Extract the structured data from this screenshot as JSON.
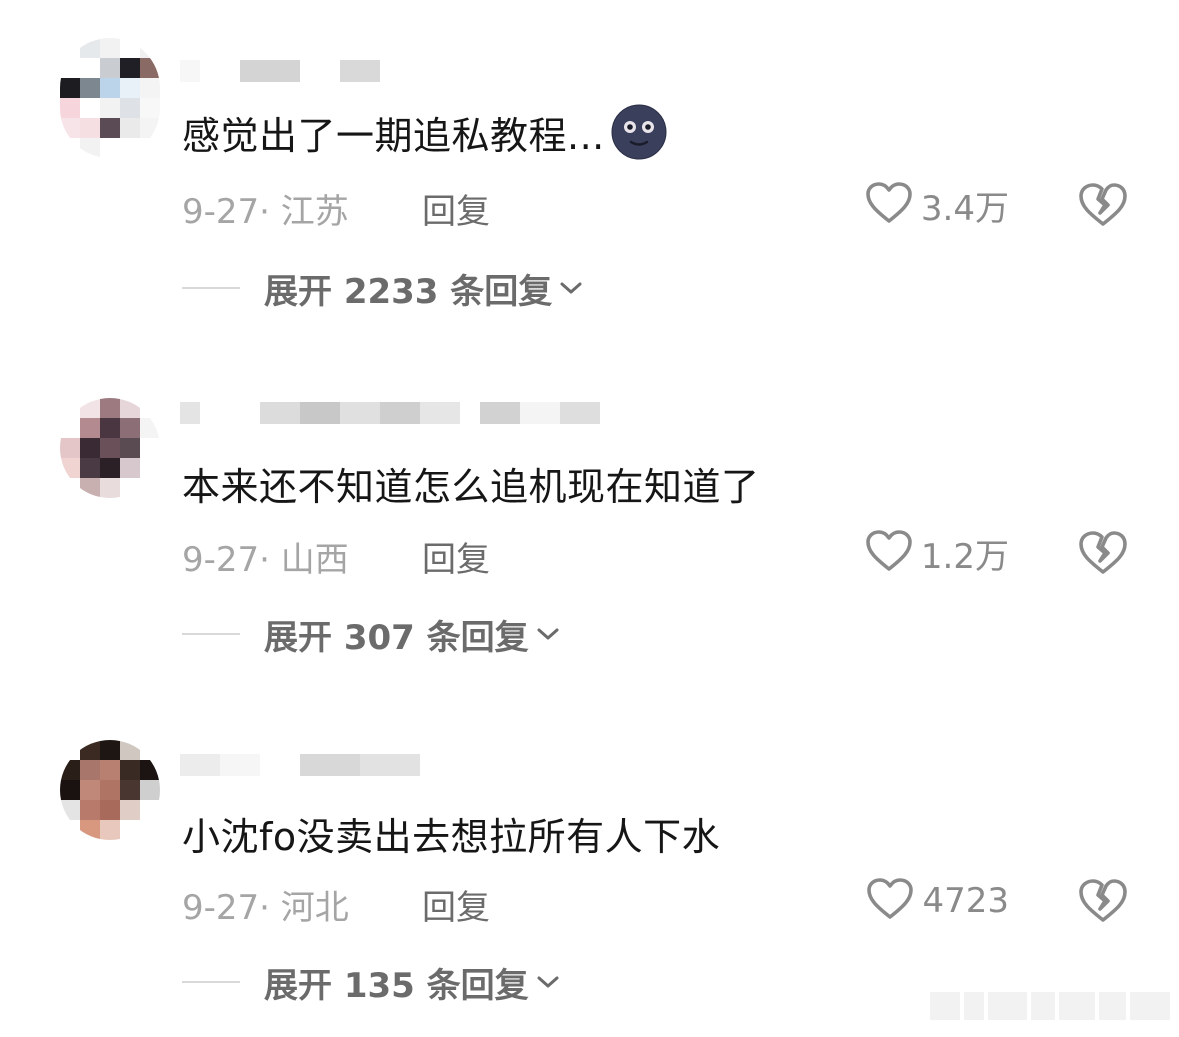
{
  "comments": [
    {
      "content": "感觉出了一期追私教程...",
      "emoji": "new-moon-face",
      "meta": "9-27· 江苏",
      "reply_label": "回复",
      "likes": "3.4万",
      "expand_label": "展开 2233 条回复"
    },
    {
      "content": "本来还不知道怎么追机现在知道了",
      "meta": "9-27· 山西",
      "reply_label": "回复",
      "likes": "1.2万",
      "expand_label": "展开 307 条回复"
    },
    {
      "content": "小沈fo没卖出去想拉所有人下水",
      "meta": "9-27· 河北",
      "reply_label": "回复",
      "likes": "4723",
      "expand_label": "展开 135 条回复"
    }
  ],
  "colors": {
    "text_primary": "#161616",
    "text_meta": "#a5a5a5",
    "text_secondary": "#6b6b6b",
    "icon": "#8a8a8a",
    "divider": "#d9d9d9"
  },
  "icons": {
    "like": "heart-outline-icon",
    "dislike": "broken-heart-icon",
    "expand": "chevron-down-icon"
  }
}
